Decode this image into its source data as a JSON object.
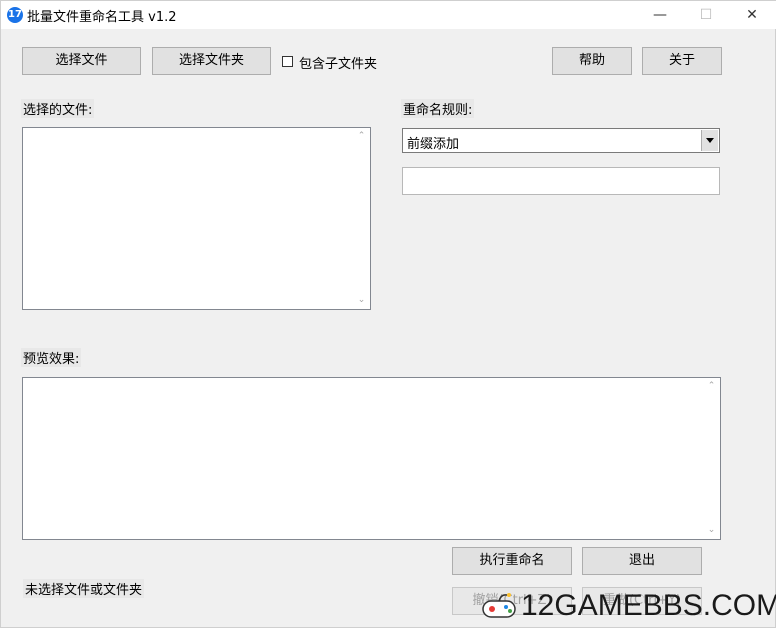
{
  "window": {
    "title": "批量文件重命名工具 v1.2",
    "app_icon_glyph": "17",
    "minimize_glyph": "—",
    "maximize_glyph": "☐",
    "close_glyph": "✕"
  },
  "toolbar": {
    "select_files": "选择文件",
    "select_folder": "选择文件夹",
    "include_subfolders": "包含子文件夹",
    "include_subfolders_checked": false,
    "help": "帮助",
    "about": "关于"
  },
  "files": {
    "label": "选择的文件:",
    "items": []
  },
  "rules": {
    "label": "重命名规则:",
    "selected": "前缀添加",
    "input_value": ""
  },
  "preview": {
    "label": "预览效果:",
    "items": []
  },
  "actions": {
    "execute": "执行重命名",
    "exit": "退出",
    "undo": "撤销(Ctrl+Z)",
    "redo": "重做(Ctrl+Y)"
  },
  "status": {
    "text": "未选择文件或文件夹"
  },
  "watermark": {
    "text": "12GAMEBBS.COM"
  }
}
